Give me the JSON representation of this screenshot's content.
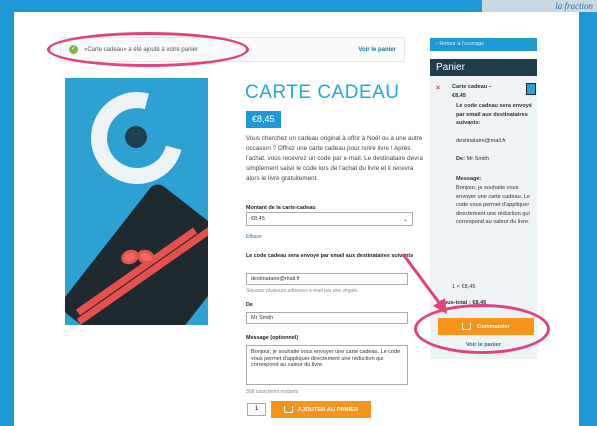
{
  "corner_text": "la fraction",
  "notice": {
    "message": "«Carte cadeau» a été ajouté à votre panier",
    "view_cart": "Voir le panier"
  },
  "product": {
    "title": "CARTE CADEAU",
    "price": "€8,45",
    "description": "Vous cherchez un cadeau original à offrir à Noël ou à une autre occasion ? Offrez une carte cadeau pour notre livre ! Après l'achat, vous recevrez un code par e-mail. Le destinataire devra simplement saisir le code lors de l'achat du livre et il recevra alors le livre gratuitement.",
    "amount_label": "Montant de la carte-cadeau",
    "amount_value": "€8,45",
    "clear_label": "Effacer",
    "email_label": "Le code cadeau sera envoyé par email aux destinataires suivants",
    "email_value": "destinataire@mail.fr",
    "email_hint": "Séparez plusieurs adresses e-mail par une virgule.",
    "from_label": "De",
    "from_value": "Mr Smith",
    "message_label": "Message (optionnel)",
    "message_value": "Bonjour, je souhaite vous envoyer une carte cadeau. Le code vous permet d'appliquer directement une réduction qui correspond au valeur du livre.",
    "chars_left": "308 caractères restants",
    "qty": "1",
    "add_button": "AJOUTER AU PANIER"
  },
  "sidebar": {
    "back": "Retour à l'ouvrage",
    "cart_title": "Panier",
    "item_name": "Carte cadeau –",
    "item_price": "€8,45",
    "recipients_heading": "Le code cadeau sera envoyé par email aux destinataires suivants:",
    "recipient": "destinataire@mail.fr",
    "from_label": "De:",
    "from_value": "Mr Smith",
    "message_label": "Message:",
    "message_value": "Bonjour, je souhaite vous envoyer une carte cadeau. Le code vous permet d'appliquer directement une réduction qui correspond au valeur du livre.",
    "qty_line": "1 × €8,45",
    "subtotal": "Sous-total : €8,45",
    "order_button": "Commander",
    "view_cart": "Voir le panier"
  },
  "colors": {
    "accent": "#1d9ad6",
    "button": "#f7941d",
    "highlight": "#e0427d",
    "header_dark": "#1f3d4d"
  }
}
